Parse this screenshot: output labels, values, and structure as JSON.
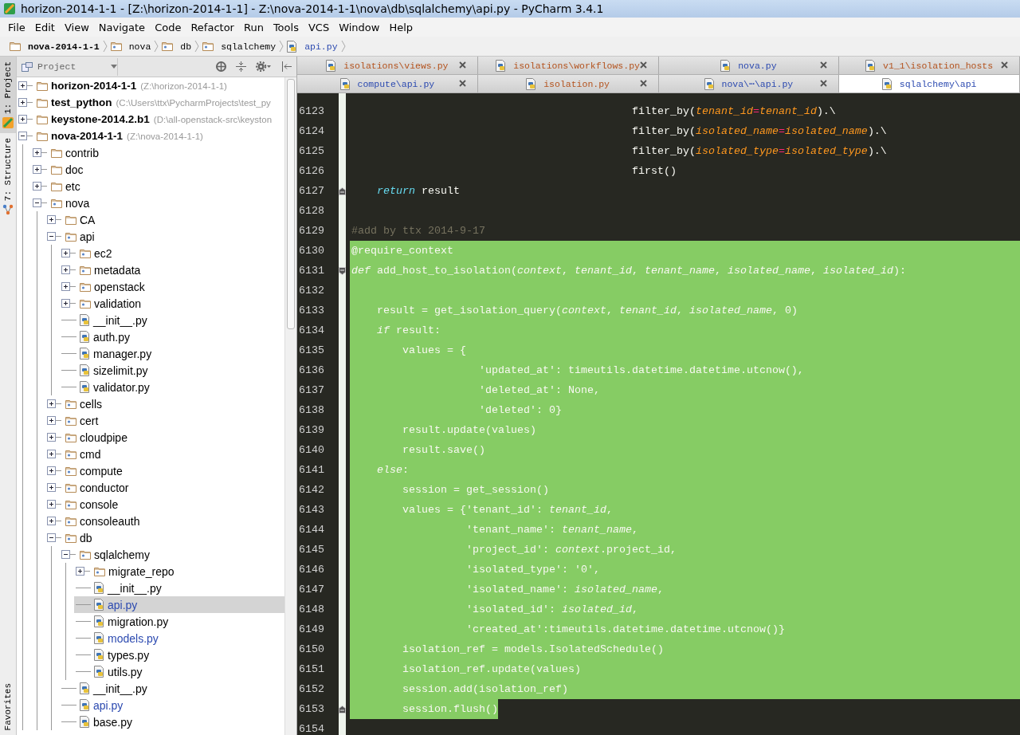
{
  "window": {
    "title": "horizon-2014-1-1 - [Z:\\horizon-2014-1-1] - Z:\\nova-2014-1-1\\nova\\db\\sqlalchemy\\api.py - PyCharm 3.4.1"
  },
  "menu": [
    "File",
    "Edit",
    "View",
    "Navigate",
    "Code",
    "Refactor",
    "Run",
    "Tools",
    "VCS",
    "Window",
    "Help"
  ],
  "breadcrumb": [
    {
      "label": "nova-2014-1-1",
      "kind": "project"
    },
    {
      "label": "nova",
      "kind": "package"
    },
    {
      "label": "db",
      "kind": "package"
    },
    {
      "label": "sqlalchemy",
      "kind": "package"
    },
    {
      "label": "api.py",
      "kind": "python"
    }
  ],
  "tool_strip": {
    "top": [
      {
        "label": "1: Project",
        "selected": true
      },
      {
        "label": "7: Structure",
        "selected": false
      }
    ],
    "bottom": [
      {
        "label": "Favorites",
        "selected": false
      }
    ]
  },
  "project_panel": {
    "view": "Project",
    "tree": [
      {
        "name": "horizon-2014-1-1",
        "hint": "(Z:\\horizon-2014-1-1)",
        "kind": "project",
        "expanded": false,
        "selected": false,
        "modified": false
      },
      {
        "name": "test_python",
        "hint": "(C:\\Users\\ttx\\PycharmProjects\\test_py",
        "kind": "project",
        "expanded": false,
        "selected": false,
        "modified": false
      },
      {
        "name": "keystone-2014.2.b1",
        "hint": "(D:\\all-openstack-src\\keyston",
        "kind": "project",
        "expanded": false,
        "selected": false,
        "modified": false
      },
      {
        "name": "nova-2014-1-1",
        "hint": "(Z:\\nova-2014-1-1)",
        "kind": "project",
        "expanded": true,
        "selected": false,
        "modified": false,
        "children": [
          {
            "name": "contrib",
            "kind": "folder",
            "expanded": false,
            "selected": false,
            "modified": false
          },
          {
            "name": "doc",
            "kind": "folder",
            "expanded": false,
            "selected": false,
            "modified": false
          },
          {
            "name": "etc",
            "kind": "folder",
            "expanded": false,
            "selected": false,
            "modified": false
          },
          {
            "name": "nova",
            "kind": "package",
            "expanded": true,
            "selected": false,
            "modified": false,
            "children": [
              {
                "name": "CA",
                "kind": "folder",
                "expanded": false,
                "selected": false,
                "modified": false
              },
              {
                "name": "api",
                "kind": "package",
                "expanded": true,
                "selected": false,
                "modified": false,
                "children": [
                  {
                    "name": "ec2",
                    "kind": "package",
                    "expanded": false,
                    "selected": false,
                    "modified": false
                  },
                  {
                    "name": "metadata",
                    "kind": "package",
                    "expanded": false,
                    "selected": false,
                    "modified": false
                  },
                  {
                    "name": "openstack",
                    "kind": "package",
                    "expanded": false,
                    "selected": false,
                    "modified": false
                  },
                  {
                    "name": "validation",
                    "kind": "package",
                    "expanded": false,
                    "selected": false,
                    "modified": false
                  },
                  {
                    "name": "__init__.py",
                    "kind": "python",
                    "selected": false,
                    "modified": false
                  },
                  {
                    "name": "auth.py",
                    "kind": "python",
                    "selected": false,
                    "modified": false
                  },
                  {
                    "name": "manager.py",
                    "kind": "python",
                    "selected": false,
                    "modified": false
                  },
                  {
                    "name": "sizelimit.py",
                    "kind": "python",
                    "selected": false,
                    "modified": false
                  },
                  {
                    "name": "validator.py",
                    "kind": "python",
                    "selected": false,
                    "modified": false
                  }
                ]
              },
              {
                "name": "cells",
                "kind": "package",
                "expanded": false,
                "selected": false,
                "modified": false
              },
              {
                "name": "cert",
                "kind": "package",
                "expanded": false,
                "selected": false,
                "modified": false
              },
              {
                "name": "cloudpipe",
                "kind": "package",
                "expanded": false,
                "selected": false,
                "modified": false
              },
              {
                "name": "cmd",
                "kind": "package",
                "expanded": false,
                "selected": false,
                "modified": false
              },
              {
                "name": "compute",
                "kind": "package",
                "expanded": false,
                "selected": false,
                "modified": false
              },
              {
                "name": "conductor",
                "kind": "package",
                "expanded": false,
                "selected": false,
                "modified": false
              },
              {
                "name": "console",
                "kind": "package",
                "expanded": false,
                "selected": false,
                "modified": false
              },
              {
                "name": "consoleauth",
                "kind": "package",
                "expanded": false,
                "selected": false,
                "modified": false
              },
              {
                "name": "db",
                "kind": "package",
                "expanded": true,
                "selected": false,
                "modified": false,
                "children": [
                  {
                    "name": "sqlalchemy",
                    "kind": "package",
                    "expanded": true,
                    "selected": false,
                    "modified": false,
                    "children": [
                      {
                        "name": "migrate_repo",
                        "kind": "package",
                        "expanded": false,
                        "selected": false,
                        "modified": false
                      },
                      {
                        "name": "__init__.py",
                        "kind": "python",
                        "selected": false,
                        "modified": false
                      },
                      {
                        "name": "api.py",
                        "kind": "python",
                        "selected": true,
                        "modified": true
                      },
                      {
                        "name": "migration.py",
                        "kind": "python",
                        "selected": false,
                        "modified": false
                      },
                      {
                        "name": "models.py",
                        "kind": "python",
                        "selected": false,
                        "modified": true
                      },
                      {
                        "name": "types.py",
                        "kind": "python",
                        "selected": false,
                        "modified": false
                      },
                      {
                        "name": "utils.py",
                        "kind": "python",
                        "selected": false,
                        "modified": false
                      }
                    ]
                  },
                  {
                    "name": "__init__.py",
                    "kind": "python",
                    "selected": false,
                    "modified": false
                  },
                  {
                    "name": "api.py",
                    "kind": "python",
                    "selected": false,
                    "modified": true
                  },
                  {
                    "name": "base.py",
                    "kind": "python",
                    "selected": false,
                    "modified": false
                  }
                ]
              }
            ]
          }
        ]
      }
    ]
  },
  "editor_tabs": [
    [
      {
        "label": "isolations\\views.py",
        "color": "#b4531e",
        "selected": false
      },
      {
        "label": "isolations\\workflows.py",
        "color": "#b4531e",
        "selected": false
      },
      {
        "label": "nova.py",
        "color": "#2c4ab0",
        "selected": false
      },
      {
        "label": "v1_1\\isolation_hosts",
        "color": "#b4531e",
        "selected": false
      }
    ],
    [
      {
        "label": "compute\\api.py",
        "color": "#2c4ab0",
        "selected": false
      },
      {
        "label": "isolation.py",
        "color": "#b4531e",
        "selected": false
      },
      {
        "label": "nova\\⋯\\api.py",
        "color": "#2c4ab0",
        "selected": false
      },
      {
        "label": "sqlalchemy\\api",
        "color": "#2c4ab0",
        "selected": true
      }
    ]
  ],
  "code": [
    {
      "num": "6123",
      "kind": "plain",
      "selected": false,
      "tokens": [
        {
          "kind": "plain",
          "text": "                                            filter_by("
        },
        {
          "kind": "param",
          "text": "tenant_id"
        },
        {
          "kind": "op",
          "text": "="
        },
        {
          "kind": "param",
          "text": "tenant_id"
        },
        {
          "kind": "plain",
          "text": ").\\"
        }
      ]
    },
    {
      "num": "6124",
      "kind": "plain",
      "selected": false,
      "tokens": [
        {
          "kind": "plain",
          "text": "                                            filter_by("
        },
        {
          "kind": "param",
          "text": "isolated_name"
        },
        {
          "kind": "op",
          "text": "="
        },
        {
          "kind": "param",
          "text": "isolated_name"
        },
        {
          "kind": "plain",
          "text": ").\\"
        }
      ]
    },
    {
      "num": "6125",
      "kind": "plain",
      "selected": false,
      "tokens": [
        {
          "kind": "plain",
          "text": "                                            filter_by("
        },
        {
          "kind": "param",
          "text": "isolated_type"
        },
        {
          "kind": "op",
          "text": "="
        },
        {
          "kind": "param",
          "text": "isolated_type"
        },
        {
          "kind": "plain",
          "text": ").\\"
        }
      ]
    },
    {
      "num": "6126",
      "kind": "plain",
      "selected": false,
      "tokens": [
        {
          "kind": "plain",
          "text": "                                            first()"
        }
      ]
    },
    {
      "num": "6127",
      "kind": "foldend",
      "selected": false,
      "tokens": [
        {
          "kind": "keyword",
          "text": "    return"
        },
        {
          "kind": "plain",
          "text": " result"
        }
      ]
    },
    {
      "num": "6128",
      "kind": "plain",
      "selected": false
    },
    {
      "num": "6129",
      "kind": "plain",
      "selected": false,
      "tokens": [
        {
          "kind": "comment",
          "text": "#add by ttx 2014-9-17"
        }
      ]
    },
    {
      "num": "6130",
      "kind": "plain",
      "selected": true,
      "full_width": true,
      "tokens": [
        {
          "kind": "plain",
          "text": "@require_context"
        }
      ]
    },
    {
      "num": "6131",
      "kind": "foldstart",
      "selected": true,
      "full_width": true,
      "tokens": [
        {
          "kind": "keyword",
          "text": "def"
        },
        {
          "kind": "plain",
          "text": " add_host_to_isolation("
        },
        {
          "kind": "param",
          "text": "context"
        },
        {
          "kind": "plain",
          "text": ", "
        },
        {
          "kind": "param",
          "text": "tenant_id"
        },
        {
          "kind": "plain",
          "text": ", "
        },
        {
          "kind": "param",
          "text": "tenant_name"
        },
        {
          "kind": "plain",
          "text": ", "
        },
        {
          "kind": "param",
          "text": "isolated_name"
        },
        {
          "kind": "plain",
          "text": ", "
        },
        {
          "kind": "param",
          "text": "isolated_id"
        },
        {
          "kind": "plain",
          "text": "):"
        }
      ]
    },
    {
      "num": "6132",
      "kind": "plain",
      "selected": true,
      "full_width": true
    },
    {
      "num": "6133",
      "kind": "plain",
      "selected": true,
      "full_width": true,
      "tokens": [
        {
          "kind": "plain",
          "text": "    result = get_isolation_query("
        },
        {
          "kind": "param",
          "text": "context"
        },
        {
          "kind": "plain",
          "text": ", "
        },
        {
          "kind": "param",
          "text": "tenant_id"
        },
        {
          "kind": "plain",
          "text": ", "
        },
        {
          "kind": "param",
          "text": "isolated_name"
        },
        {
          "kind": "plain",
          "text": ", 0)"
        }
      ]
    },
    {
      "num": "6134",
      "kind": "plain",
      "selected": true,
      "full_width": true,
      "tokens": [
        {
          "kind": "keyword",
          "text": "    if"
        },
        {
          "kind": "plain",
          "text": " result:"
        }
      ]
    },
    {
      "num": "6135",
      "kind": "plain",
      "selected": true,
      "full_width": true,
      "tokens": [
        {
          "kind": "plain",
          "text": "        values = {"
        }
      ]
    },
    {
      "num": "6136",
      "kind": "plain",
      "selected": true,
      "full_width": true,
      "tokens": [
        {
          "kind": "plain",
          "text": "                    'updated_at': timeutils.datetime.datetime.utcnow(),"
        }
      ]
    },
    {
      "num": "6137",
      "kind": "plain",
      "selected": true,
      "full_width": true,
      "tokens": [
        {
          "kind": "plain",
          "text": "                    'deleted_at': None,"
        }
      ]
    },
    {
      "num": "6138",
      "kind": "plain",
      "selected": true,
      "full_width": true,
      "tokens": [
        {
          "kind": "plain",
          "text": "                    'deleted': 0}"
        }
      ]
    },
    {
      "num": "6139",
      "kind": "plain",
      "selected": true,
      "full_width": true,
      "tokens": [
        {
          "kind": "plain",
          "text": "        result.update(values)"
        }
      ]
    },
    {
      "num": "6140",
      "kind": "plain",
      "selected": true,
      "full_width": true,
      "tokens": [
        {
          "kind": "plain",
          "text": "        result.save()"
        }
      ]
    },
    {
      "num": "6141",
      "kind": "plain",
      "selected": true,
      "full_width": true,
      "tokens": [
        {
          "kind": "keyword",
          "text": "    else"
        },
        {
          "kind": "plain",
          "text": ":"
        }
      ]
    },
    {
      "num": "6142",
      "kind": "plain",
      "selected": true,
      "full_width": true,
      "tokens": [
        {
          "kind": "plain",
          "text": "        session = get_session()"
        }
      ]
    },
    {
      "num": "6143",
      "kind": "plain",
      "selected": true,
      "full_width": true,
      "tokens": [
        {
          "kind": "plain",
          "text": "        values = {'tenant_id': "
        },
        {
          "kind": "param",
          "text": "tenant_id"
        },
        {
          "kind": "plain",
          "text": ","
        }
      ]
    },
    {
      "num": "6144",
      "kind": "plain",
      "selected": true,
      "full_width": true,
      "tokens": [
        {
          "kind": "plain",
          "text": "                  'tenant_name': "
        },
        {
          "kind": "param",
          "text": "tenant_name"
        },
        {
          "kind": "plain",
          "text": ","
        }
      ]
    },
    {
      "num": "6145",
      "kind": "plain",
      "selected": true,
      "full_width": true,
      "tokens": [
        {
          "kind": "plain",
          "text": "                  'project_id': "
        },
        {
          "kind": "param",
          "text": "context"
        },
        {
          "kind": "plain",
          "text": ".project_id,"
        }
      ]
    },
    {
      "num": "6146",
      "kind": "plain",
      "selected": true,
      "full_width": true,
      "tokens": [
        {
          "kind": "plain",
          "text": "                  'isolated_type': '0',"
        }
      ]
    },
    {
      "num": "6147",
      "kind": "plain",
      "selected": true,
      "full_width": true,
      "tokens": [
        {
          "kind": "plain",
          "text": "                  'isolated_name': "
        },
        {
          "kind": "param",
          "text": "isolated_name"
        },
        {
          "kind": "plain",
          "text": ","
        }
      ]
    },
    {
      "num": "6148",
      "kind": "plain",
      "selected": true,
      "full_width": true,
      "tokens": [
        {
          "kind": "plain",
          "text": "                  'isolated_id': "
        },
        {
          "kind": "param",
          "text": "isolated_id"
        },
        {
          "kind": "plain",
          "text": ","
        }
      ]
    },
    {
      "num": "6149",
      "kind": "plain",
      "selected": true,
      "full_width": true,
      "tokens": [
        {
          "kind": "plain",
          "text": "                  'created_at':timeutils.datetime.datetime.utcnow()}"
        }
      ]
    },
    {
      "num": "6150",
      "kind": "plain",
      "selected": true,
      "full_width": true,
      "tokens": [
        {
          "kind": "plain",
          "text": "        isolation_ref = models.IsolatedSchedule()"
        }
      ]
    },
    {
      "num": "6151",
      "kind": "plain",
      "selected": true,
      "full_width": true,
      "tokens": [
        {
          "kind": "plain",
          "text": "        isolation_ref.update(values)"
        }
      ]
    },
    {
      "num": "6152",
      "kind": "plain",
      "selected": true,
      "full_width": true,
      "tokens": [
        {
          "kind": "plain",
          "text": "        session.add(isolation_ref)"
        }
      ]
    },
    {
      "num": "6153",
      "kind": "foldend",
      "selected": true,
      "full_width": false,
      "tokens": [
        {
          "kind": "plain",
          "text": "        session.flush()"
        }
      ]
    },
    {
      "num": "6154",
      "kind": "plain",
      "selected": false
    }
  ]
}
